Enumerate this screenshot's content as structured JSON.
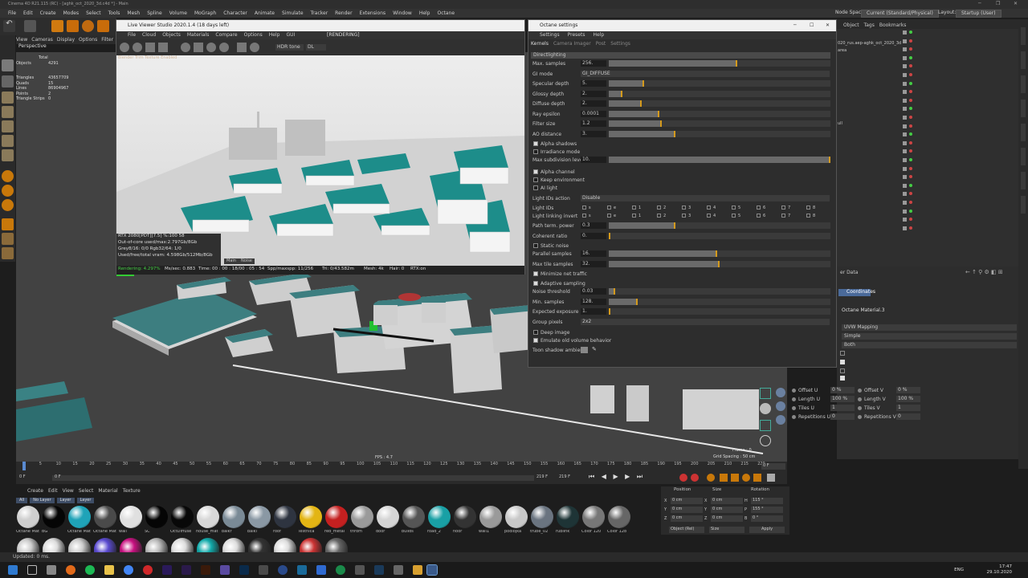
{
  "window": {
    "title": "Cinema 4D R21.115 (RC) - [aghk_oct_2020_3d.c4d *] - Main"
  },
  "menubar": {
    "items": [
      "File",
      "Edit",
      "Create",
      "Modes",
      "Select",
      "Tools",
      "Mesh",
      "Spline",
      "Volume",
      "MoGraph",
      "Character",
      "Animate",
      "Simulate",
      "Tracker",
      "Render",
      "Extensions",
      "Window",
      "Help",
      "Octane"
    ],
    "node_space_label": "Node Space:",
    "node_space_value": "Current (Standard/Physical)",
    "layout_label": "Layout:",
    "layout_value": "Startup (User)"
  },
  "viewport": {
    "menu": [
      "View",
      "Cameras",
      "Display",
      "Options",
      "Filter"
    ],
    "camera": "Perspective",
    "stats": {
      "header": "Total",
      "rows": [
        [
          "Objects",
          "4291"
        ],
        [
          "Triangles",
          "43657709"
        ],
        [
          "Quads",
          "15"
        ],
        [
          "Lines",
          "86904967"
        ],
        [
          "Points",
          "2"
        ],
        [
          "Triangle Strips",
          "0"
        ]
      ]
    },
    "fps": "FPS : 4.7",
    "frame": "Frame : 0",
    "grid": "Grid Spacing : 50 cm"
  },
  "live_viewer": {
    "title": "Live Viewer Studio 2020.1.4 (18 days left)",
    "menu": [
      "File",
      "Cloud",
      "Objects",
      "Materials",
      "Compare",
      "Options",
      "Help",
      "GUI"
    ],
    "status_tag": "[RENDERING]",
    "tone": "HDR tone",
    "tone_val": "DL",
    "overlay_text": "Blender Trim Texture Enabled",
    "info": [
      "RTX 2080[PDT][7.5]   %:100   58",
      "Out-of-core used/max:2.797Gb/8Gb",
      "Grey8/16: 0/0       Rgb32/64: 1/0",
      "Used/free/total vram: 4.598Gb/512Mb/8Gb"
    ],
    "info_tabs": [
      "Main",
      "Noise"
    ],
    "status": {
      "rendering": "Rendering: 4.297%",
      "ms": "Ms/sec: 0.883",
      "time": "Time: 00 : 00 : 18/00 : 05 : 54",
      "spp": "Spp/maxspp: 11/256",
      "tri": "Tri: 0/43.582m",
      "mesh": "Mesh: 4k",
      "hair": "Hair: 0",
      "rtx": "RTX:on"
    },
    "progress": 0.043
  },
  "octane": {
    "title": "Octane settings",
    "menu": [
      "Settings",
      "Presets",
      "Help"
    ],
    "tabs": [
      "Kernels",
      "Camera Imager",
      "Post",
      "Settings"
    ],
    "kernel": "Directlighting",
    "params": [
      {
        "label": "Max. samples",
        "value": "256.",
        "fill": 0.58
      },
      {
        "label": "GI mode",
        "dropdown": "GI_DIFFUSE"
      },
      {
        "label": "Specular depth",
        "value": "5.",
        "fill": 0.16
      },
      {
        "label": "Glossy depth",
        "value": "2.",
        "fill": 0.06
      },
      {
        "label": "Diffuse depth",
        "value": "2.",
        "fill": 0.15
      },
      {
        "label": "Ray epsilon",
        "value": "0.0001",
        "fill": 0.23
      },
      {
        "label": "Filter size",
        "value": "1.2",
        "fill": 0.24
      },
      {
        "label": "AO distance",
        "value": "3.",
        "fill": 0.3
      }
    ],
    "checks1": [
      {
        "label": "Alpha shadows",
        "on": true
      },
      {
        "label": "Irradiance mode",
        "on": false
      }
    ],
    "max_subdiv": {
      "label": "Max subdivision level",
      "value": "10.",
      "fill": 1.0
    },
    "checks2": [
      {
        "label": "Alpha channel",
        "on": true
      },
      {
        "label": "Keep environment",
        "on": false
      },
      {
        "label": "AI light",
        "on": false
      }
    ],
    "light_ids_action": {
      "label": "Light IDs action",
      "dropdown": "Disable"
    },
    "light_ids": {
      "label": "Light IDs",
      "nums": [
        "s",
        "e",
        "1",
        "2",
        "3",
        "4",
        "5",
        "6",
        "7",
        "8"
      ]
    },
    "light_link": {
      "label": "Light linking invert",
      "nums": [
        "s",
        "e",
        "1",
        "2",
        "3",
        "4",
        "5",
        "6",
        "7",
        "8"
      ]
    },
    "params2": [
      {
        "label": "Path term. power",
        "value": "0.3",
        "fill": 0.3
      },
      {
        "label": "Coherent ratio",
        "value": "0.",
        "fill": 0.0
      }
    ],
    "static_noise": {
      "label": "Static noise",
      "on": false
    },
    "params3": [
      {
        "label": "Parallel samples",
        "value": "16.",
        "fill": 0.49
      },
      {
        "label": "Max tile samples",
        "value": "32.",
        "fill": 0.5
      }
    ],
    "minimize": {
      "label": "Minimize net traffic",
      "on": true
    },
    "adaptive": {
      "label": "Adaptive sampling",
      "on": true
    },
    "params4": [
      {
        "label": "Noise threshold",
        "value": "0.03",
        "fill": 0.03
      },
      {
        "label": "Min. samples",
        "value": "128.",
        "fill": 0.13
      },
      {
        "label": "Expected exposure",
        "value": "1.",
        "fill": 0.0
      }
    ],
    "group_pixels": {
      "label": "Group pixels",
      "dropdown": "2x2"
    },
    "checks3": [
      {
        "label": "Deep image",
        "on": false
      },
      {
        "label": "Emulate old volume behavior",
        "on": true
      }
    ],
    "toon": "Toon shadow ambient"
  },
  "right": {
    "tabs": [
      "Object",
      "Tags",
      "Bookmarks"
    ],
    "file": "020_rus.aep-aghk_oct_2020_3d",
    "item_a": "area",
    "item_b": "ull",
    "attr_title": "er Data",
    "coords": "Coordinates",
    "mat_name": "Octane Material.3",
    "rows": [
      "UVW Mapping",
      "Simple",
      "Both"
    ],
    "uvw": [
      [
        "Offset U",
        "0 %",
        "Offset V",
        "0 %"
      ],
      [
        "Length U",
        "100 %",
        "Length V",
        "100 %"
      ],
      [
        "Tiles U",
        "1",
        "Tiles V",
        "1"
      ],
      [
        "Repetitions U",
        "0",
        "Repetitions V",
        "0"
      ]
    ]
  },
  "timeline": {
    "ticks": [
      "0",
      "5",
      "10",
      "15",
      "20",
      "25",
      "30",
      "35",
      "40",
      "45",
      "50",
      "55",
      "60",
      "65",
      "70",
      "75",
      "80",
      "85",
      "90",
      "95",
      "100",
      "105",
      "110",
      "115",
      "120",
      "125",
      "130",
      "135",
      "140",
      "145",
      "150",
      "155",
      "160",
      "165",
      "170",
      "175",
      "180",
      "185",
      "190",
      "195",
      "200",
      "205",
      "210",
      "215",
      "220"
    ],
    "end_field": "0 F",
    "start": "0 F",
    "cur": "0 F",
    "end_a": "219 F",
    "end_b": "219 F"
  },
  "materials": {
    "menu": [
      "Create",
      "Edit",
      "View",
      "Select",
      "Material",
      "Texture"
    ],
    "filters": [
      "All",
      "No Layer",
      "Layer",
      "Layer"
    ],
    "items": [
      {
        "name": "Octane Mat",
        "color": "#cfcfcf"
      },
      {
        "name": "BG",
        "color": "#050505"
      },
      {
        "name": "Octane Mat",
        "color": "#1fa3b8"
      },
      {
        "name": "Octane Mat",
        "color": "#4a4a4a"
      },
      {
        "name": "wall",
        "color": "#e0e0e0"
      },
      {
        "name": "SC",
        "color": "#050505"
      },
      {
        "name": "OctDiffuse",
        "color": "#080808"
      },
      {
        "name": "house_mat",
        "color": "#d8d8d8"
      },
      {
        "name": "balkr",
        "color": "#7a8a96"
      },
      {
        "name": "balki",
        "color": "#8a98a4"
      },
      {
        "name": "roof",
        "color": "#2e3440"
      },
      {
        "name": "lestnica",
        "color": "#e3b514"
      },
      {
        "name": "red_metal",
        "color": "#c42020"
      },
      {
        "name": "throm",
        "color": "#9a9a9a"
      },
      {
        "name": "door",
        "color": "#d5d5d5"
      },
      {
        "name": "builds",
        "color": "#555"
      },
      {
        "name": "road_2",
        "color": "#19a0a5"
      },
      {
        "name": "floor",
        "color": "#333"
      },
      {
        "name": "wall1",
        "color": "#9a9a9a"
      },
      {
        "name": "podlojka",
        "color": "#c8c8c8"
      },
      {
        "name": "trube_02",
        "color": "#6a7480"
      },
      {
        "name": "rublink",
        "color": "#1e3436"
      },
      {
        "name": "Color 120",
        "color": "#777"
      },
      {
        "name": "Color 128",
        "color": "#666"
      }
    ],
    "row2": [
      "#ccc",
      "#ddd",
      "#ccc",
      "#5a4ad0",
      "#c81080",
      "#bbb",
      "#ddd",
      "#1aa",
      "#ddd",
      "#333",
      "#ddd",
      "#c33",
      "#666"
    ]
  },
  "coords": {
    "headers": [
      "Position",
      "Size",
      "Rotation"
    ],
    "rows": [
      [
        "X",
        "0 cm",
        "X",
        "0 cm",
        "H",
        "115 °"
      ],
      [
        "Y",
        "0 cm",
        "Y",
        "0 cm",
        "P",
        "155 °"
      ],
      [
        "Z",
        "0 cm",
        "Z",
        "0 cm",
        "B",
        "0 °"
      ]
    ],
    "mode": "Object (Rel)",
    "size_mode": "Size",
    "apply": "Apply"
  },
  "status": "Updated: 0 ms.",
  "taskbar": {
    "lang": "ENG",
    "time": "17:47",
    "date": "29.10.2020"
  }
}
